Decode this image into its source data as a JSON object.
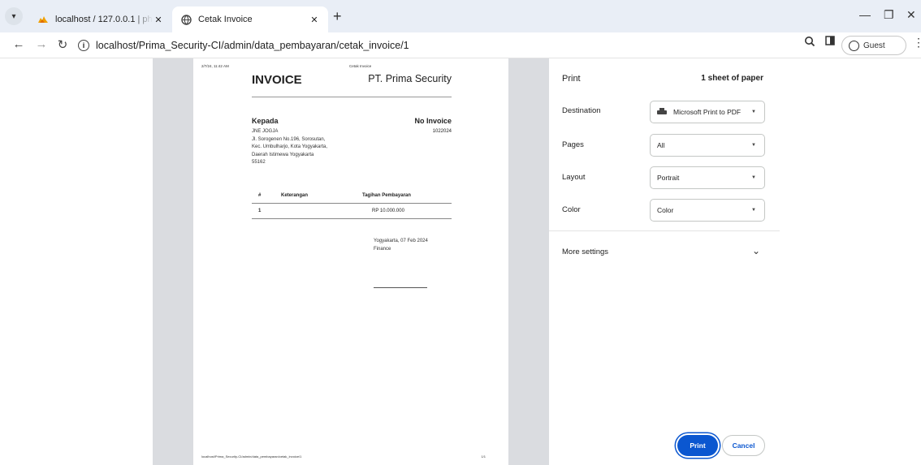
{
  "browser": {
    "tabs": [
      {
        "title": "localhost / 127.0.0.1 | phpMyAdmin",
        "active": false,
        "close": "✕"
      },
      {
        "title": "Cetak Invoice",
        "active": true,
        "close": "✕"
      }
    ],
    "new_tab": "+",
    "url": "localhost/Prima_Security-CI/admin/data_pembayaran/cetak_invoice/1",
    "profile_label": "Guest",
    "icons": {
      "tab_search": "chevron-down-icon",
      "favicon1": "phpmyadmin-icon",
      "favicon2": "globe-icon",
      "back": "arrow-left-icon",
      "forward": "arrow-right-icon",
      "reload": "reload-icon",
      "info": "info-icon",
      "zoom": "zoom-icon",
      "sidepanel": "side-panel-icon",
      "menu": "kebab-menu-icon"
    }
  },
  "preview": {
    "header_date": "2/7/24, 11:42 AM",
    "header_title": "Cetak Invoice",
    "footer_url": "localhost/Prima_Security-CI/admin/data_pembayaran/cetak_invoice/1",
    "footer_page": "1/1",
    "invoice": {
      "title": "INVOICE",
      "company": "PT. Prima Security",
      "to_label": "Kepada",
      "to_name": "JNE JOGJA",
      "address_lines": [
        "Jl. Sorogenen No.196, Sorosutan,",
        "Kec. Umbulharjo, Kota Yogyakarta,",
        "Daerah Istimewa Yogyakarta",
        "55162"
      ],
      "no_invoice_label": "No Invoice",
      "no_invoice_value": "1022024",
      "table": {
        "headers": [
          "#",
          "Keterangan",
          "Tagihan Pembayaran"
        ],
        "rows": [
          [
            "1",
            "",
            "RP 10.000.000"
          ]
        ]
      },
      "place_date": "Yogyakarta, 07 Feb 2024",
      "signer": "Finance"
    }
  },
  "print_panel": {
    "title": "Print",
    "sheets": "1 sheet of paper",
    "destination_label": "Destination",
    "destination_value": "Microsoft Print to PDF",
    "pages_label": "Pages",
    "pages_value": "All",
    "layout_label": "Layout",
    "layout_value": "Portrait",
    "color_label": "Color",
    "color_value": "Color",
    "more_settings": "More settings",
    "print_button": "Print",
    "cancel_button": "Cancel"
  },
  "colors": {
    "tabbar": "#e9eef6",
    "preview_bg": "#dadce0",
    "primary_button": "#0b57d0"
  }
}
